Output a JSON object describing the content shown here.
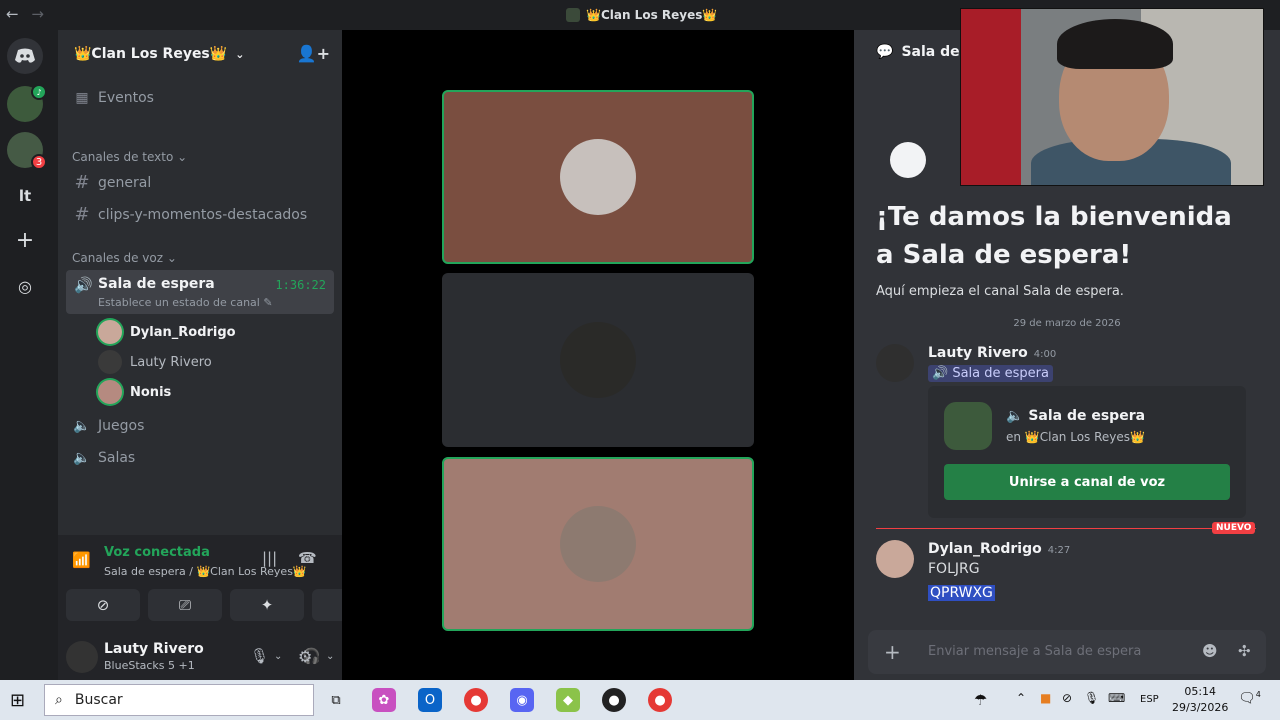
{
  "window": {
    "title": "👑Clan Los Reyes👑",
    "back_glyph": "←",
    "forward_glyph": "→"
  },
  "servers": {
    "badge_count": "3",
    "lt_label": "lt",
    "add_glyph": "+",
    "explore_glyph": "◎"
  },
  "sidebar": {
    "guild_name": "👑Clan Los Reyes👑",
    "events_label": "Eventos",
    "text_category": "Canales de texto",
    "text_channels": [
      "general",
      "clips-y-momentos-destacados"
    ],
    "voice_category": "Canales de voz",
    "active_voice": {
      "name": "Sala de espera",
      "timer": "1:36:22",
      "status": "Establece un estado de canal"
    },
    "members": [
      "Dylan_Rodrigo",
      "Lauty Rivero",
      "Nonis"
    ],
    "other_voice_channels": [
      "Juegos",
      "Salas"
    ]
  },
  "voice_panel": {
    "connected": "Voz conectada",
    "location": "Sala de espera / 👑Clan Los Reyes👑"
  },
  "user": {
    "name": "Lauty Rivero",
    "activity": "BlueStacks 5 +1"
  },
  "chat": {
    "channel_name": "Sala de espera",
    "welcome_title": "¡Te damos la bienvenida a Sala de espera!",
    "welcome_sub": "Aquí empieza el canal Sala de espera.",
    "date": "29 de marzo de 2026",
    "messages": [
      {
        "author": "Lauty Rivero",
        "time": "4:00",
        "mention": "🔊 Sala de espera"
      },
      {
        "author": "Dylan_Rodrigo",
        "time": "4:27",
        "text": "FOLJRG",
        "selected": "QPRWXG"
      }
    ],
    "embed": {
      "title": "Sala de espera",
      "sub": "en 👑Clan Los Reyes👑",
      "join_label": "Unirse a canal de voz"
    },
    "new_label": "NUEVO",
    "composer_placeholder": "Enviar mensaje a Sala de espera"
  },
  "taskbar": {
    "search_label": "Buscar",
    "lang": "ESP",
    "time": "05:14",
    "date": "29/3/2026",
    "notif_count": "4"
  },
  "colors": {
    "green": "#23a55a",
    "red": "#f23f43",
    "blurple": "#5865f2"
  }
}
